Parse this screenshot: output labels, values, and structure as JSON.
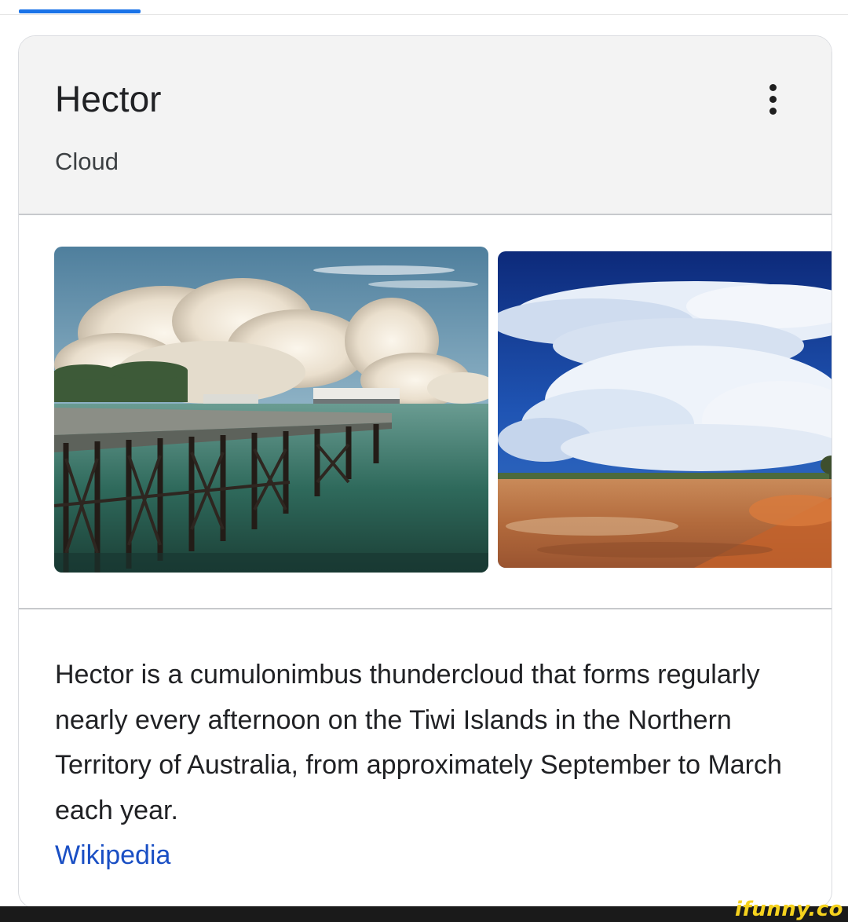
{
  "colors": {
    "top_indicator": "#1a73e8",
    "link": "#1a4fc4",
    "watermark": "#f5d21e"
  },
  "header": {
    "title": "Hector",
    "subtitle": "Cloud",
    "more_icon": "vertical-dots-icon"
  },
  "images": [
    {
      "name": "pier-with-thundercloud-photo"
    },
    {
      "name": "thundercloud-over-red-plain-photo"
    }
  ],
  "description": {
    "text": "Hector is a cumulonimbus thundercloud that forms regularly nearly every afternoon on the Tiwi Islands in the Northern Territory of Australia, from approximately September to March each year.",
    "source_link": "Wikipedia"
  },
  "watermark": "ifunny.co"
}
